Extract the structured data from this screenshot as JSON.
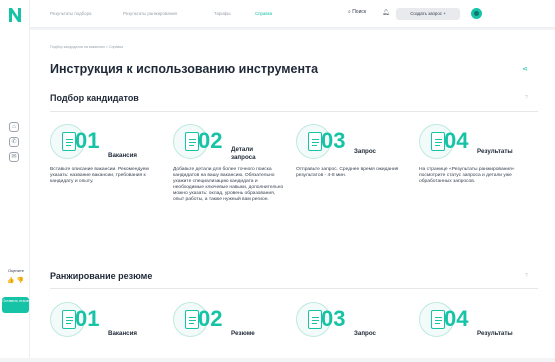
{
  "nav": {
    "links": [
      "Результаты подбора",
      "Результаты ранжирования",
      "Тарифы",
      "Справка"
    ],
    "search_label": "Поиск",
    "create_label": "Создать запрос +"
  },
  "side": {
    "rate_label": "Оцените",
    "review_label": "Оставить отзыв"
  },
  "page": {
    "breadcrumb": "Подбор кандидатов на вакансию  >  Справка",
    "title": "Инструкция к использованию инструмента"
  },
  "sections": [
    {
      "title": "Подбор кандидатов",
      "help": "?",
      "cards": [
        {
          "num": "01",
          "label": "Вакансия",
          "desc": "Вставьте описание вакансии. Рекомендуем указать: название вакансии, требования к кандидату и опыту."
        },
        {
          "num": "02",
          "label": "Детали запроса",
          "desc": "Добавьте детали для более точного поиска кандидатов на вашу вакансию. Обязательно укажите специализацию кандидата и необходимые ключевые навыки, дополнительно можно указать: оклад, уровень образования, опыт работы, а также нужный вам регион."
        },
        {
          "num": "03",
          "label": "Запрос",
          "desc": "Отправьте запрос. Среднее время ожидания результатов - 4-8 мин."
        },
        {
          "num": "04",
          "label": "Результаты",
          "desc": "На странице «Результаты ранжирования» посмотрите статус запроса и детали уже обработанных запросов."
        }
      ]
    },
    {
      "title": "Ранжирование резюме",
      "help": "?",
      "cards": [
        {
          "num": "01",
          "label": "Вакансия"
        },
        {
          "num": "02",
          "label": "Резюме"
        },
        {
          "num": "03",
          "label": "Запрос"
        },
        {
          "num": "04",
          "label": "Результаты"
        }
      ]
    }
  ],
  "colors": {
    "accent": "#17c3a6"
  }
}
